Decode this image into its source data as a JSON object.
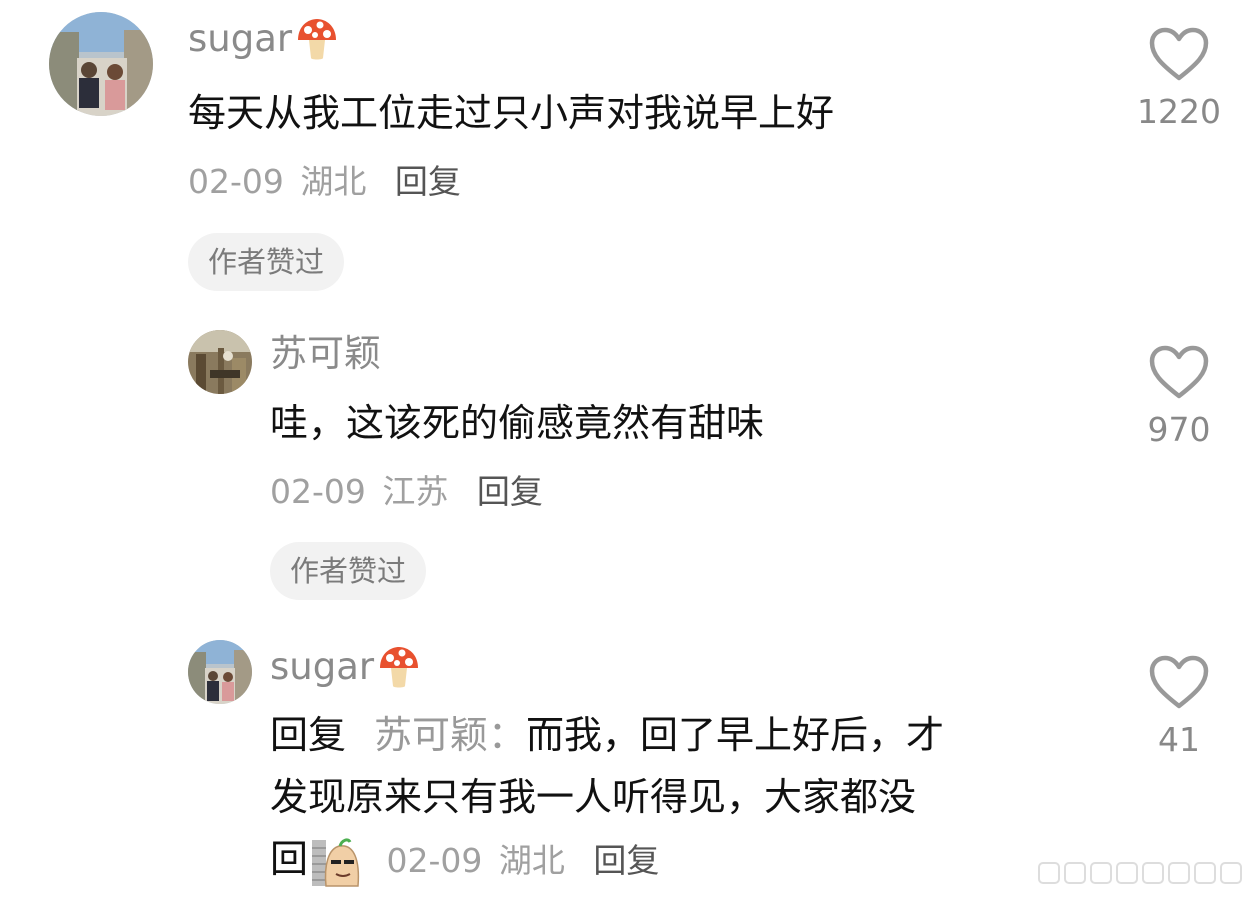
{
  "comments": [
    {
      "username": "sugar",
      "badge_icon": "mushroom-icon",
      "text": "每天从我工位走过只小声对我说早上好",
      "date": "02-09",
      "location": "湖北",
      "reply_label": "回复",
      "author_liked": "作者赞过",
      "likes": "1220"
    },
    {
      "username": "苏可颖",
      "text": "哇，这该死的偷感竟然有甜味",
      "date": "02-09",
      "location": "江苏",
      "reply_label": "回复",
      "author_liked": "作者赞过",
      "likes": "970"
    },
    {
      "username": "sugar",
      "badge_icon": "mushroom-icon",
      "reply_prefix": "回复",
      "reply_target": "苏可颖：",
      "text_line1": "而我，回了早上好后，才",
      "text_line2": "发现原来只有我一人听得见，大家都没",
      "text_line3": "回",
      "sticker_icon": "sticker-icon",
      "date": "02-09",
      "location": "湖北",
      "reply_label": "回复",
      "likes": "41"
    }
  ],
  "colors": {
    "text_primary": "#111111",
    "text_secondary": "#8a8a8a",
    "badge_bg": "#f2f2f2",
    "mushroom_red": "#e8512f"
  }
}
